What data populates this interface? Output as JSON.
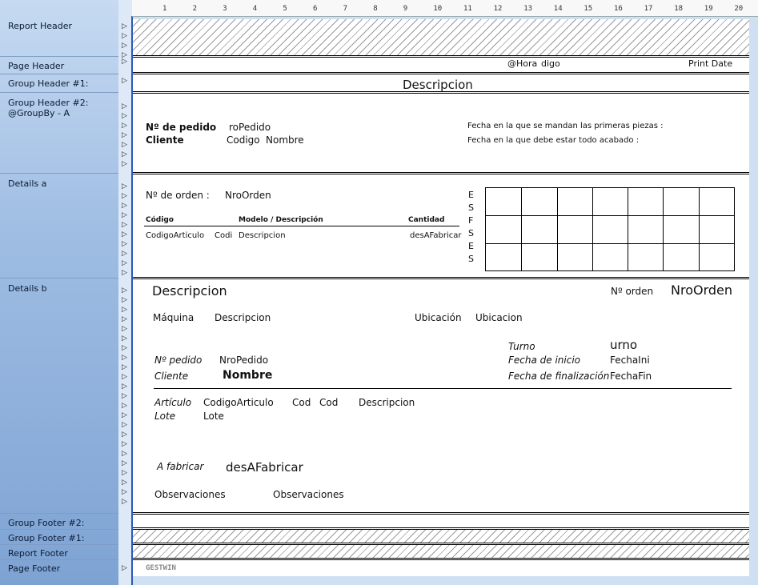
{
  "sections": {
    "report_header": "Report Header",
    "page_header": "Page Header",
    "group_header_1": "Group Header #1:",
    "group_header_2": "Group Header #2:\n @GroupBy - A",
    "details_a": "Details a",
    "details_b": "Details b",
    "group_footer_2": "Group Footer #2:",
    "group_footer_1": "Group Footer #1:",
    "report_footer": "Report Footer",
    "page_footer": "Page Footer"
  },
  "ruler_ticks": [
    "1",
    "2",
    "3",
    "4",
    "5",
    "6",
    "7",
    "8",
    "9",
    "10",
    "11",
    "12",
    "13",
    "14",
    "15",
    "16",
    "17",
    "18",
    "19",
    "20"
  ],
  "page_header": {
    "hora": "@Hora",
    "codigo": "digo",
    "print_date": "Print Date"
  },
  "group_header_1": {
    "descripcion": "Descripcion"
  },
  "group_header_2": {
    "n_pedido_label": "Nº de pedido",
    "n_pedido_value": "roPedido",
    "cliente_label": "Cliente",
    "cliente_codigo": "Codigo",
    "cliente_nombre": "Nombre",
    "fecha_primeras": "Fecha en la que se mandan las primeras piezas :",
    "fecha_acabado": "Fecha en la que debe estar todo acabado :"
  },
  "details_a": {
    "n_orden_label": "Nº de orden :",
    "n_orden_value": "NroOrden",
    "col_codigo": "Código",
    "col_modelo": "Modelo / Descripción",
    "col_cantidad": "Cantidad",
    "codigo_articulo": "CodigoArticulo",
    "codi": "Codi",
    "descripcion": "Descripcion",
    "des_a_fabricar": "desAFabricar",
    "vertical_letters": [
      "E",
      "S",
      "F",
      "S",
      "E",
      "S"
    ]
  },
  "details_b": {
    "descripcion_big": "Descripcion",
    "n_orden_label": "Nº orden",
    "n_orden_value": "NroOrden",
    "maquina_label": "Máquina",
    "maquina_desc": "Descripcion",
    "ubicacion_label": "Ubicación",
    "ubicacion_value": "Ubicacion",
    "turno_label": "Turno",
    "turno_value": "urno",
    "fecha_inicio_label": "Fecha de inicio",
    "fecha_ini_value": "FechaIni",
    "fecha_fin_label": "Fecha de finalización",
    "fecha_fin_value": "FechaFin",
    "n_pedido_label": "Nº pedido",
    "n_pedido_value": "NroPedido",
    "cliente_label": "Cliente",
    "cliente_nombre": "Nombre",
    "articulo_label": "Artículo",
    "lote_label": "Lote",
    "codigo_articulo": "CodigoArticulo",
    "lote_value": "Lote",
    "cod1": "Cod",
    "cod2": "Cod",
    "art_descripcion": "Descripcion",
    "a_fabricar_label": "A fabricar",
    "a_fabricar_value": "desAFabricar",
    "observaciones_label": "Observaciones",
    "observaciones_value": "Observaciones"
  },
  "page_footer": {
    "gestwin": "GESTWIN"
  }
}
